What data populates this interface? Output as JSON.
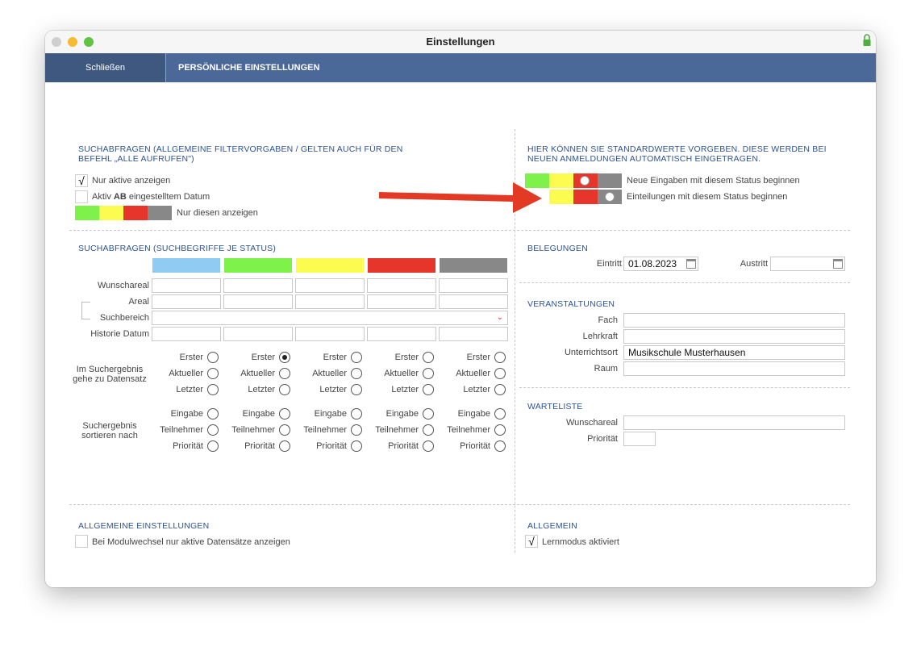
{
  "window": {
    "title": "Einstellungen"
  },
  "toolbar": {
    "close_label": "Schließen",
    "title": "PERSÖNLICHE EINSTELLUNGEN"
  },
  "colors": {
    "lightblue": "#8fcbf3",
    "green": "#7ef24a",
    "yellow": "#fbfb50",
    "red": "#e6352b",
    "gray": "#888888",
    "header": "#2d5393"
  },
  "left": {
    "section1": {
      "header": "SUCHABFRAGEN (ALLGEMEINE FILTERVORGABEN / GELTEN AUCH FÜR DEN BEFEHL „ALLE AUFRUFEN\")",
      "only_active": {
        "label": "Nur aktive anzeigen",
        "checked": true,
        "mark": "√"
      },
      "active_from_pre": "Aktiv ",
      "active_from_bold": "AB",
      "active_from_post": " eingestelltem Datum",
      "only_these": "Nur diesen anzeigen"
    },
    "section2": {
      "header": "SUCHABFRAGEN (SUCHBEGRIFFE JE STATUS)",
      "rows": [
        "Wunschareal",
        "Areal",
        "Suchbereich",
        "Historie Datum"
      ],
      "goto_label_line1": "Im Suchergebnis",
      "goto_label_line2": "gehe zu Datensatz",
      "goto_options": [
        "Erster",
        "Aktueller",
        "Letzter"
      ],
      "sort_label_line1": "Suchergebnis",
      "sort_label_line2": "sortieren nach",
      "sort_options": [
        "Eingabe",
        "Teilnehmer",
        "Priorität"
      ],
      "selected_goto": "Erster (green column)"
    },
    "section3": {
      "header": "ALLGEMEINE EINSTELLUNGEN",
      "module_switch": "Bei Modulwechsel nur aktive Datensätze anzeigen"
    }
  },
  "right": {
    "defaults": {
      "header_line1": "HIER KÖNNEN SIE STANDARDWERTE VORGEBEN. DIESE WERDEN BEI",
      "header_line2": "NEUEN ANMELDUNGEN AUTOMATISCH EINGETRAGEN.",
      "new_entries": "Neue Eingaben mit diesem Status beginnen",
      "assignments": "Einteilungen mit diesem Status beginnen"
    },
    "belegungen": {
      "header": "BELEGUNGEN",
      "entry_label": "Eintritt",
      "entry_value": "01.08.2023",
      "exit_label": "Austritt",
      "exit_value": ""
    },
    "veranstaltungen": {
      "header": "VERANSTALTUNGEN",
      "fach": "Fach",
      "lehrkraft": "Lehrkraft",
      "unterrichtsort": "Unterrichtsort",
      "unterrichtsort_value": "Musikschule Musterhausen",
      "raum": "Raum"
    },
    "warteliste": {
      "header": "WARTELISTE",
      "wunschareal": "Wunschareal",
      "prioritaet": "Priorität"
    },
    "allgemein": {
      "header": "ALLGEMEIN",
      "lernmodus": "Lernmodus aktiviert",
      "lernmodus_checked": true,
      "mark": "√"
    }
  }
}
